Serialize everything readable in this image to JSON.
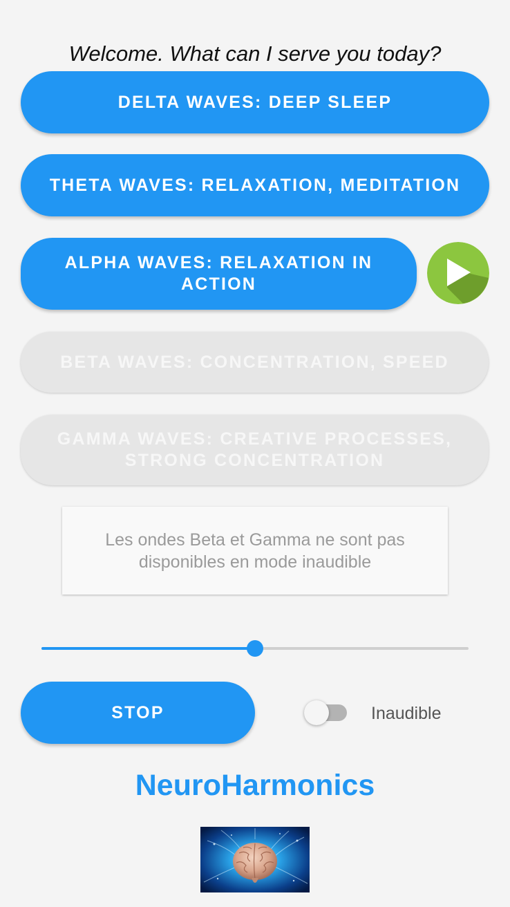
{
  "header": {
    "welcome_text": "Welcome. What can I serve you today?"
  },
  "waves": {
    "delta": {
      "label": "DELTA WAVES: DEEP SLEEP",
      "enabled": true
    },
    "theta": {
      "label": "THETA WAVES: RELAXATION, MEDITATION",
      "enabled": true
    },
    "alpha": {
      "label": "ALPHA WAVES: RELAXATION IN ACTION",
      "enabled": true,
      "playing": true
    },
    "beta": {
      "label": "BETA WAVES: CONCENTRATION, SPEED",
      "enabled": false
    },
    "gamma": {
      "label": "GAMMA WAVES: CREATIVE PROCESSES, STRONG CONCENTRATION",
      "enabled": false
    }
  },
  "info": {
    "message": "Les ondes Beta et Gamma ne sont pas disponibles en mode inaudible"
  },
  "volume_slider": {
    "value_percent": 50
  },
  "controls": {
    "stop_label": "STOP",
    "inaudible_label": "Inaudible",
    "inaudible_on": false
  },
  "footer": {
    "app_name": "NeuroHarmonics"
  },
  "icons": {
    "play": "play-icon",
    "brain": "brain-icon"
  },
  "colors": {
    "primary": "#2196f3",
    "play_button": "#8cc63f",
    "play_button_shadow": "#6e9e2c",
    "disabled_button": "#e6e6e6",
    "background": "#f4f4f4"
  }
}
